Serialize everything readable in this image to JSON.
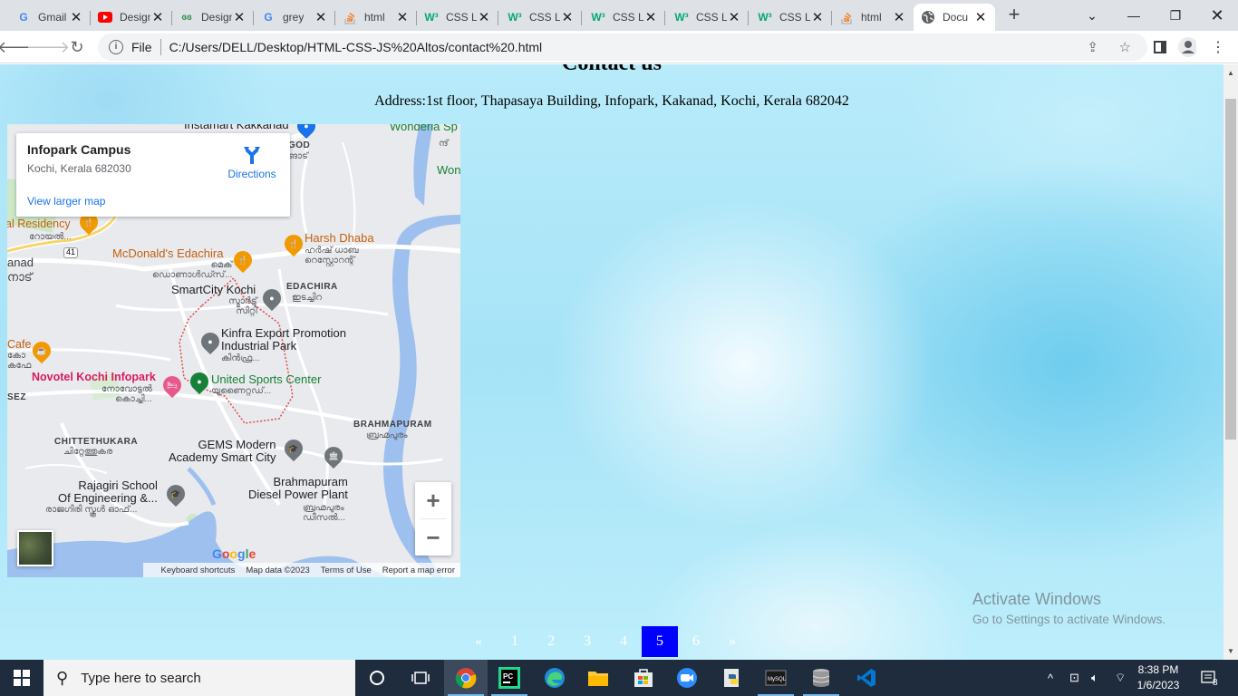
{
  "browser": {
    "tabs": [
      {
        "title": "Gmail",
        "icon": "google-icon",
        "color": "#4285f4"
      },
      {
        "title": "Design",
        "icon": "youtube-icon",
        "color": "#ff0000"
      },
      {
        "title": "Design",
        "icon": "geeksforgeeks-icon",
        "color": "#2f8d46"
      },
      {
        "title": "grey",
        "icon": "google-icon",
        "color": "#4285f4"
      },
      {
        "title": "html",
        "icon": "stackoverflow-icon",
        "color": "#f48024"
      },
      {
        "title": "CSS L",
        "icon": "w3schools-icon",
        "color": "#04aa6d"
      },
      {
        "title": "CSS L",
        "icon": "w3schools-icon",
        "color": "#04aa6d"
      },
      {
        "title": "CSS L",
        "icon": "w3schools-icon",
        "color": "#04aa6d"
      },
      {
        "title": "CSS L",
        "icon": "w3schools-icon",
        "color": "#04aa6d"
      },
      {
        "title": "CSS L",
        "icon": "w3schools-icon",
        "color": "#04aa6d"
      },
      {
        "title": "html",
        "icon": "stackoverflow-icon",
        "color": "#f48024"
      },
      {
        "title": "Docu",
        "icon": "globe-icon",
        "color": "#5f6368",
        "active": true
      }
    ],
    "new_tab": "+",
    "address": {
      "scheme_label": "File",
      "url": "C:/Users/DELL/Desktop/HTML-CSS-JS%20Altos/contact%20.html"
    }
  },
  "page": {
    "title": "Contact us",
    "address": "Address:1st floor, Thapasaya Building, Infopark, Kakanad, Kochi, Kerala 682042"
  },
  "map": {
    "info_card": {
      "name": "Infopark Campus",
      "address": "Kochi, Kerala 682030",
      "directions": "Directions",
      "larger_map": "View larger map"
    },
    "labels": {
      "instamart": "Instamart Kakkanad",
      "wonderla": "Wonderla Sp",
      "won": "Won",
      "wond_ml": "ന്ദ്",
      "god": "GOD",
      "god_ml": "ങാട്",
      "residency": "al Residency",
      "residency_ml": "റോയൽ...",
      "kakkanad": "anad",
      "kakkanad_ml": "നാട്",
      "road41": "41",
      "mcdonalds": "McDonald's Edachira",
      "mcdonalds_ml": "മെക്\nഡൊണാൾഡ്സ്...",
      "harsh": "Harsh Dhaba",
      "harsh_ml": "ഹർഷ് ധാബ\nറെസ്റ്റോറന്റ്",
      "smartcity": "SmartCity Kochi",
      "smartcity_ml": "സ്മാർട്ട്\nസിറ്റി",
      "edachira": "EDACHIRA",
      "edachira_ml": "ഇടച്ചിറ",
      "kinfra": "Kinfra Export Promotion\nIndustrial Park",
      "kinfra_ml": "കിൻഫ്ര...",
      "cafe": "Cafe",
      "cafe_ml": "കോ\nകഫേ",
      "novotel": "Novotel Kochi Infopark",
      "novotel_ml": "നോവോട്ടൽ\nകൊച്ചി...",
      "united": "United Sports Center",
      "united_ml": "യുണൈറ്റഡ്...",
      "sez": "SEZ",
      "brahmapuram": "BRAHMAPURAM",
      "brahmapuram_ml": "ബ്രഹ്മപുരം",
      "chittethukara": "CHITTETHUKARA",
      "chittethukara_ml": "ചിറ്റേത്തുകര",
      "gems": "GEMS Modern\nAcademy Smart City",
      "rajagiri": "Rajagiri School\nOf Engineering &...",
      "rajagiri_ml": "രാജഗിരി സ്കൂൾ ഓഫ്...",
      "diesel": "Brahmapuram\nDiesel Power Plant",
      "diesel_ml": "ബ്രഹ്മപുരം\nഡീസൽ..."
    },
    "zoom_in": "+",
    "zoom_out": "−",
    "google_logo": "Google",
    "attribution": [
      "Keyboard shortcuts",
      "Map data ©2023",
      "Terms of Use",
      "Report a map error"
    ]
  },
  "pagination": {
    "items": [
      "«",
      "1",
      "2",
      "3",
      "4",
      "5",
      "6",
      "»"
    ],
    "active": "5",
    "active_color": "#0000ff"
  },
  "watermark": {
    "line1": "Activate Windows",
    "line2": "Go to Settings to activate Windows."
  },
  "taskbar": {
    "search_placeholder": "Type here to search",
    "time": "8:38 PM",
    "date": "1/6/2023",
    "notification_count": "8",
    "apps": [
      "cortana-icon",
      "task-view-icon",
      "chrome-icon",
      "pycharm-icon",
      "edge-icon",
      "file-explorer-icon",
      "store-icon",
      "zoom-icon",
      "python-icon",
      "mysql-icon",
      "database-icon",
      "vscode-icon"
    ]
  }
}
